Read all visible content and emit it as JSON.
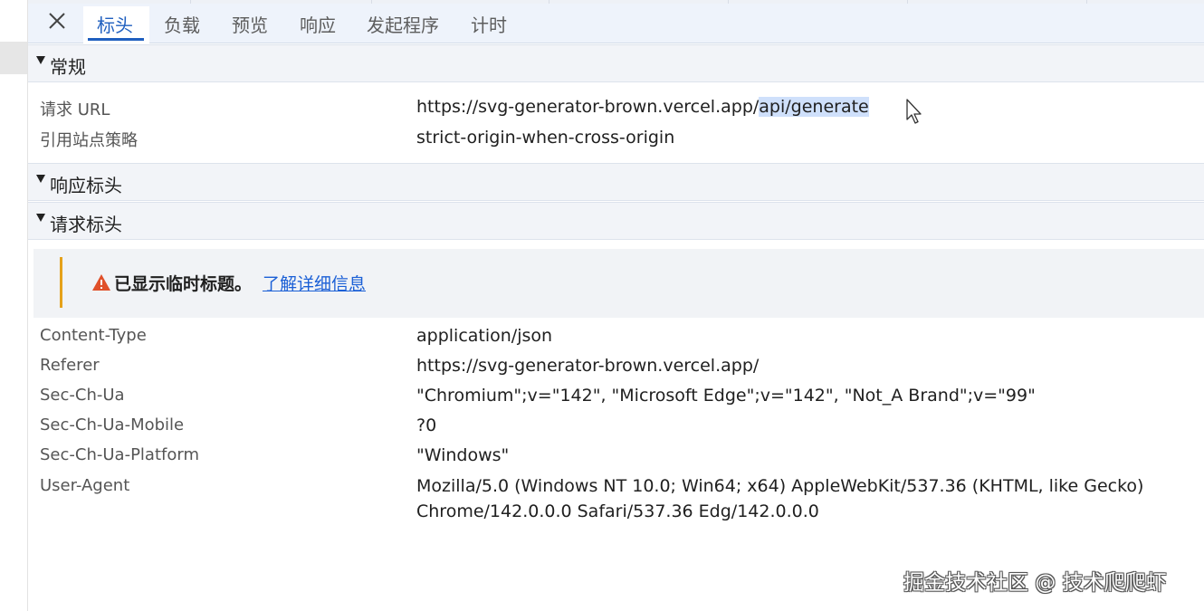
{
  "tabs": [
    {
      "label": "标头",
      "active": true
    },
    {
      "label": "负载",
      "active": false
    },
    {
      "label": "预览",
      "active": false
    },
    {
      "label": "响应",
      "active": false
    },
    {
      "label": "发起程序",
      "active": false
    },
    {
      "label": "计时",
      "active": false
    }
  ],
  "sections": {
    "general": "常规",
    "response_headers": "响应标头",
    "request_headers": "请求标头"
  },
  "general": {
    "request_url_label": "请求 URL",
    "request_url_prefix": "https://svg-generator-brown.vercel.app/",
    "request_url_selected": "api/generate",
    "referrer_policy_label": "引用站点策略",
    "referrer_policy_value": "strict-origin-when-cross-origin"
  },
  "warning": {
    "text": "已显示临时标题。",
    "link": "了解详细信息",
    "color": "#e5a11a"
  },
  "request_headers": [
    {
      "name": "Content-Type",
      "value": "application/json"
    },
    {
      "name": "Referer",
      "value": "https://svg-generator-brown.vercel.app/"
    },
    {
      "name": "Sec-Ch-Ua",
      "value": "\"Chromium\";v=\"142\", \"Microsoft Edge\";v=\"142\", \"Not_A Brand\";v=\"99\""
    },
    {
      "name": "Sec-Ch-Ua-Mobile",
      "value": "?0"
    },
    {
      "name": "Sec-Ch-Ua-Platform",
      "value": "\"Windows\""
    },
    {
      "name": "User-Agent",
      "value_line1": "Mozilla/5.0 (Windows NT 10.0; Win64; x64) AppleWebKit/537.36 (KHTML, like Gecko)",
      "value_line2": "Chrome/142.0.0.0 Safari/537.36 Edg/142.0.0.0"
    }
  ],
  "watermark": "掘金技术社区 @ 技术爬爬虾",
  "colors": {
    "accent": "#1f5fbf",
    "link": "#1a5fd6",
    "selection": "#cfe0fb"
  },
  "icons": {
    "close": "close-icon",
    "collapse": "triangle-down-icon",
    "warning": "warning-icon",
    "cursor": "mouse-pointer-icon"
  }
}
